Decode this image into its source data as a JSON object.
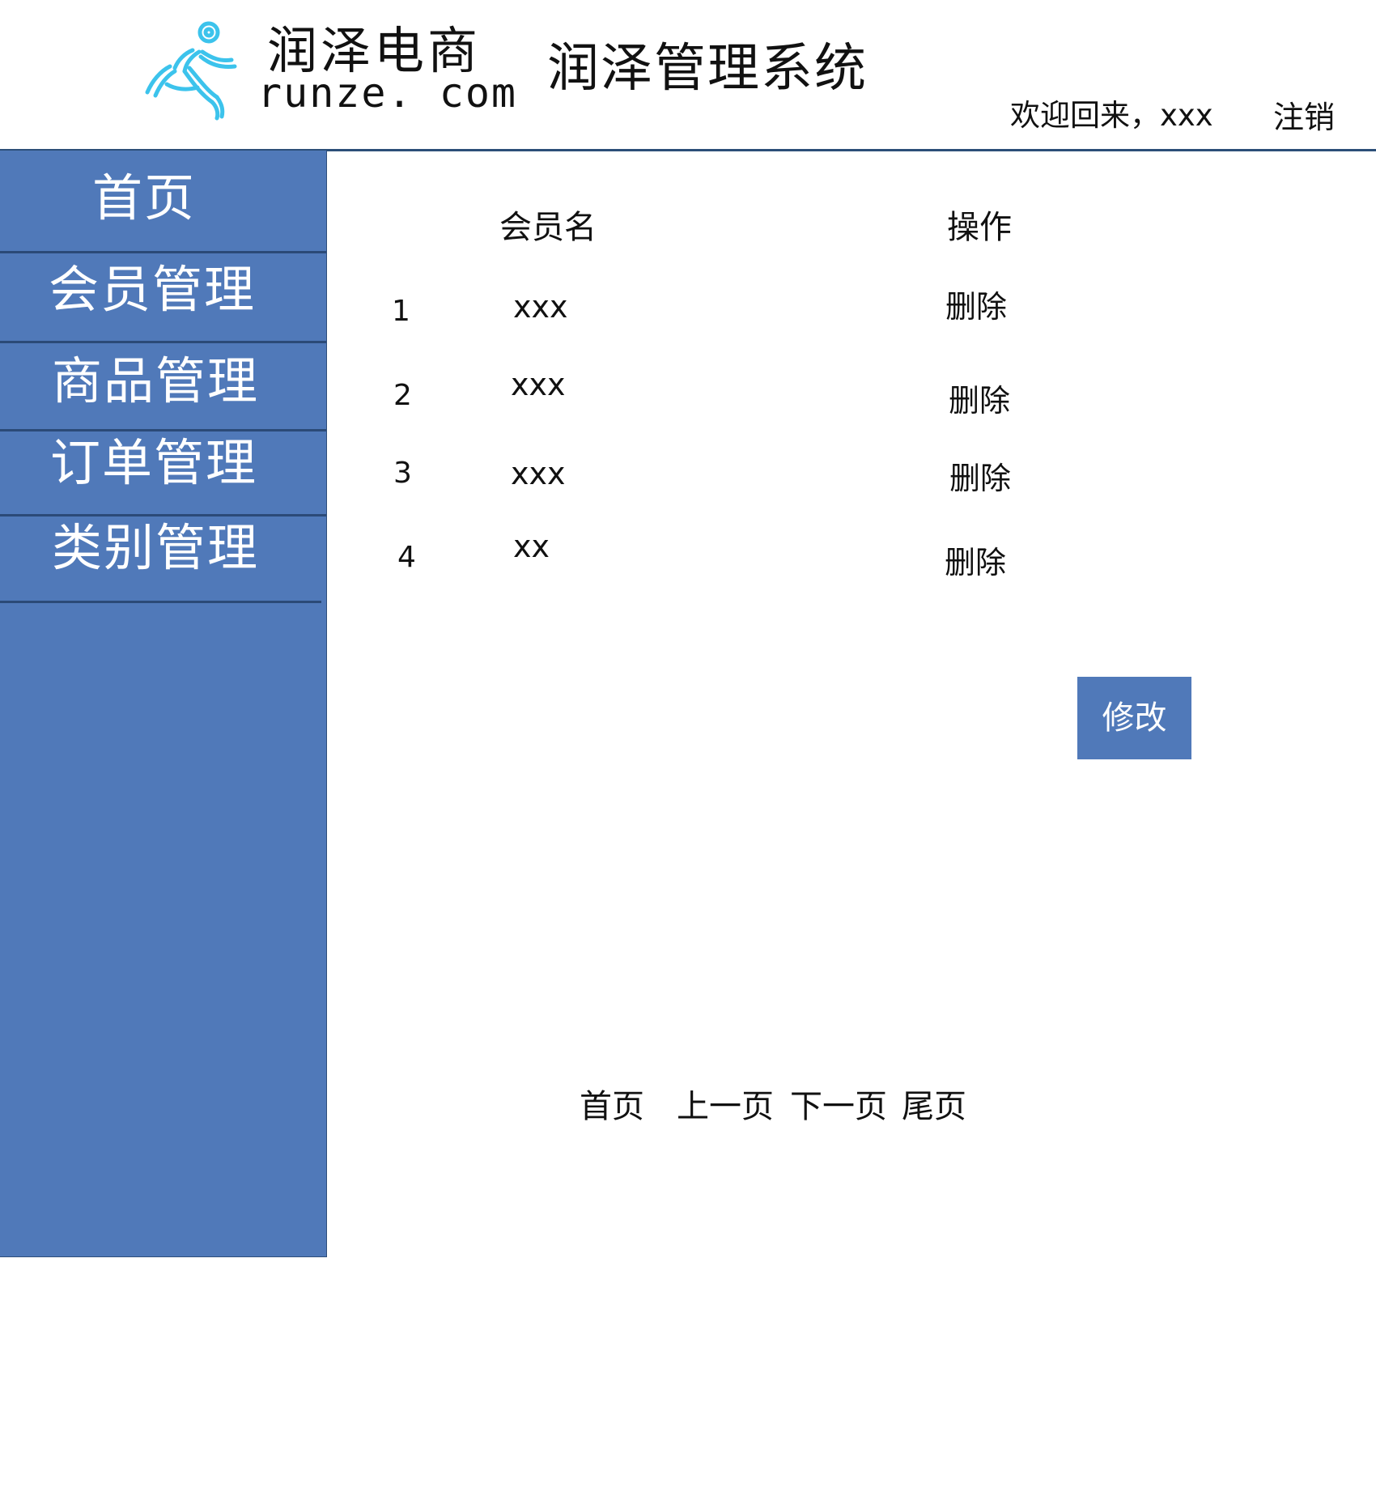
{
  "header": {
    "brand_cn": "润泽电商",
    "brand_en": "runze. com",
    "system_title": "润泽管理系统",
    "welcome": "欢迎回来，xxx",
    "logout": "注销"
  },
  "colors": {
    "sidebar": "#5079b9",
    "divider": "#2b4a77",
    "logo": "#3cc3ec",
    "button": "#5079b9"
  },
  "icons": {
    "logo": "running-person-logo-icon"
  },
  "sidebar": {
    "items": [
      {
        "label": "首页"
      },
      {
        "label": "会员管理"
      },
      {
        "label": "商品管理"
      },
      {
        "label": "订单管理"
      },
      {
        "label": "类别管理"
      }
    ]
  },
  "table": {
    "headers": {
      "name": "会员名",
      "action": "操作"
    },
    "rows": [
      {
        "index": "1",
        "name": "xxx",
        "action": "删除"
      },
      {
        "index": "2",
        "name": "xxx",
        "action": "删除"
      },
      {
        "index": "3",
        "name": "xxx",
        "action": "删除"
      },
      {
        "index": "4",
        "name": "xx",
        "action": "删除"
      }
    ]
  },
  "edit_button": "修改",
  "pagination": {
    "first": "首页",
    "prev": "上一页",
    "next": "下一页",
    "last": "尾页"
  }
}
